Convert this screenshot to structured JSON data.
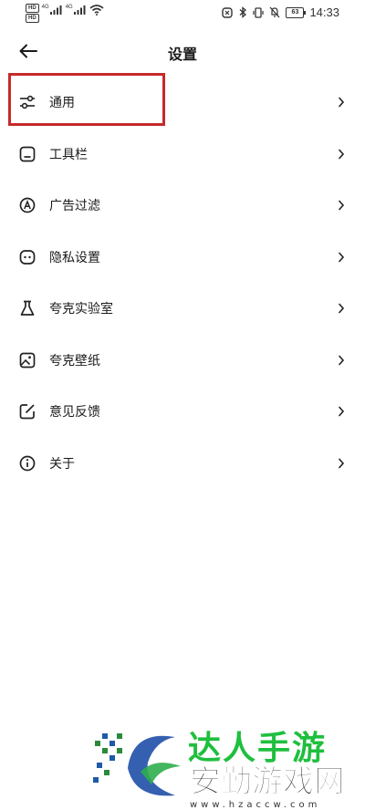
{
  "status_bar": {
    "hd_top": "HD",
    "hd_bottom": "HD",
    "net_1": "4G",
    "net_2": "4G",
    "battery": "63",
    "time": "14:33"
  },
  "header": {
    "title": "设置"
  },
  "items": [
    {
      "label": "通用",
      "icon": "sliders-icon"
    },
    {
      "label": "工具栏",
      "icon": "toolbar-icon"
    },
    {
      "label": "广告过滤",
      "icon": "ad-filter-icon"
    },
    {
      "label": "隐私设置",
      "icon": "privacy-mask-icon"
    },
    {
      "label": "夸克实验室",
      "icon": "flask-icon"
    },
    {
      "label": "夸克壁纸",
      "icon": "wallpaper-icon"
    },
    {
      "label": "意见反馈",
      "icon": "feedback-edit-icon"
    },
    {
      "label": "关于",
      "icon": "info-icon"
    }
  ],
  "highlighted_item": "通用",
  "watermark": {
    "top_text": "达人手游",
    "main_text": "安勤游戏网",
    "url": "www.hzaccw.com"
  },
  "colors": {
    "highlight": "#c62a2a",
    "watermark_green": "#1fbf3e",
    "watermark_blue": "#1f4fa8"
  }
}
